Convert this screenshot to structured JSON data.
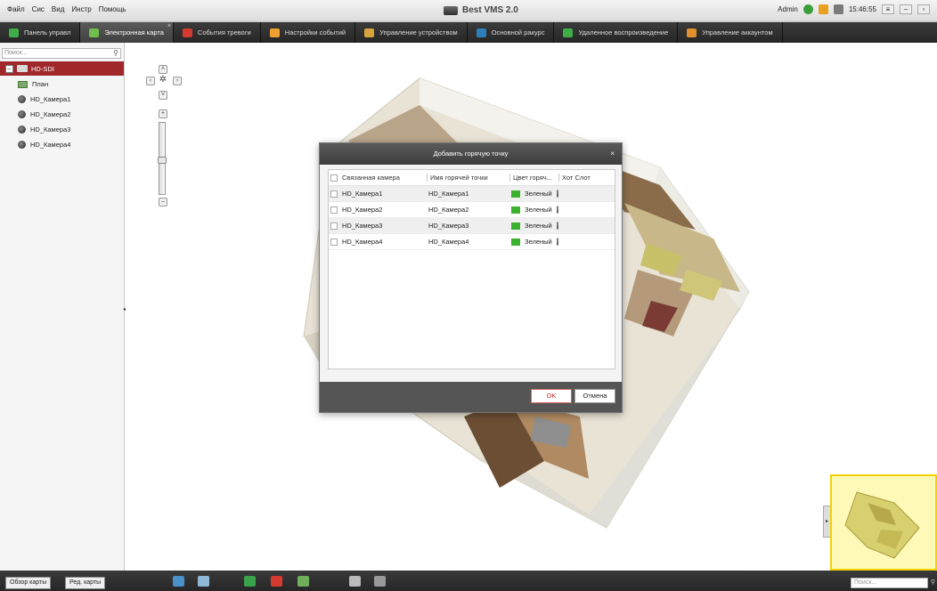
{
  "window": {
    "title": "Best VMS 2.0",
    "menu": [
      "Файл",
      "Сис",
      "Вид",
      "Инстр",
      "Помощь"
    ],
    "user": "Admin",
    "clock": "15:46:55"
  },
  "tabs": [
    {
      "label": "Панель управл",
      "icon_color": "#3fae49",
      "active": false
    },
    {
      "label": "Электронная карта",
      "icon_color": "#6fbf4a",
      "active": true,
      "close": "×"
    },
    {
      "label": "События тревоги",
      "icon_color": "#d43a2e",
      "active": false
    },
    {
      "label": "Настройки событий",
      "icon_color": "#f0a030",
      "active": false
    },
    {
      "label": "Управление устройством",
      "icon_color": "#d9a33c",
      "active": false
    },
    {
      "label": "Основной ракурс",
      "icon_color": "#2c7fb8",
      "active": false
    },
    {
      "label": "Удаленное воспроизведение",
      "icon_color": "#3fae49",
      "active": false
    },
    {
      "label": "Управление аккаунтом",
      "icon_color": "#e0902c",
      "active": false
    }
  ],
  "sidebar": {
    "search_placeholder": "Поиск...",
    "root": "HD-SDI",
    "items": [
      {
        "label": "План",
        "icon": "plan-icon"
      },
      {
        "label": "HD_Камера1",
        "icon": "camera-icon"
      },
      {
        "label": "HD_Камера2",
        "icon": "camera-icon"
      },
      {
        "label": "HD_Камера3",
        "icon": "camera-icon"
      },
      {
        "label": "HD_Камера4",
        "icon": "camera-icon"
      }
    ]
  },
  "dialog": {
    "title": "Добавить горячую точку",
    "columns": [
      "Связанная камера",
      "Имя горячей точки",
      "Цвет горяч...",
      "Хот Слот"
    ],
    "rows": [
      {
        "camera": "HD_Камера1",
        "name": "HD_Камера1",
        "color_name": "Зеленый",
        "color": "#3bb22e"
      },
      {
        "camera": "HD_Камера2",
        "name": "HD_Камера2",
        "color_name": "Зеленый",
        "color": "#3bb22e"
      },
      {
        "camera": "HD_Камера3",
        "name": "HD_Камера3",
        "color_name": "Зеленый",
        "color": "#3bb22e"
      },
      {
        "camera": "HD_Камера4",
        "name": "HD_Камера4",
        "color_name": "Зеленый",
        "color": "#3bb22e"
      }
    ],
    "ok": "OK",
    "cancel": "Отмена"
  },
  "bottom": {
    "tab_overview": "Обзор карты",
    "tab_edit": "Ред. карты",
    "search_placeholder": "Поиск..."
  }
}
